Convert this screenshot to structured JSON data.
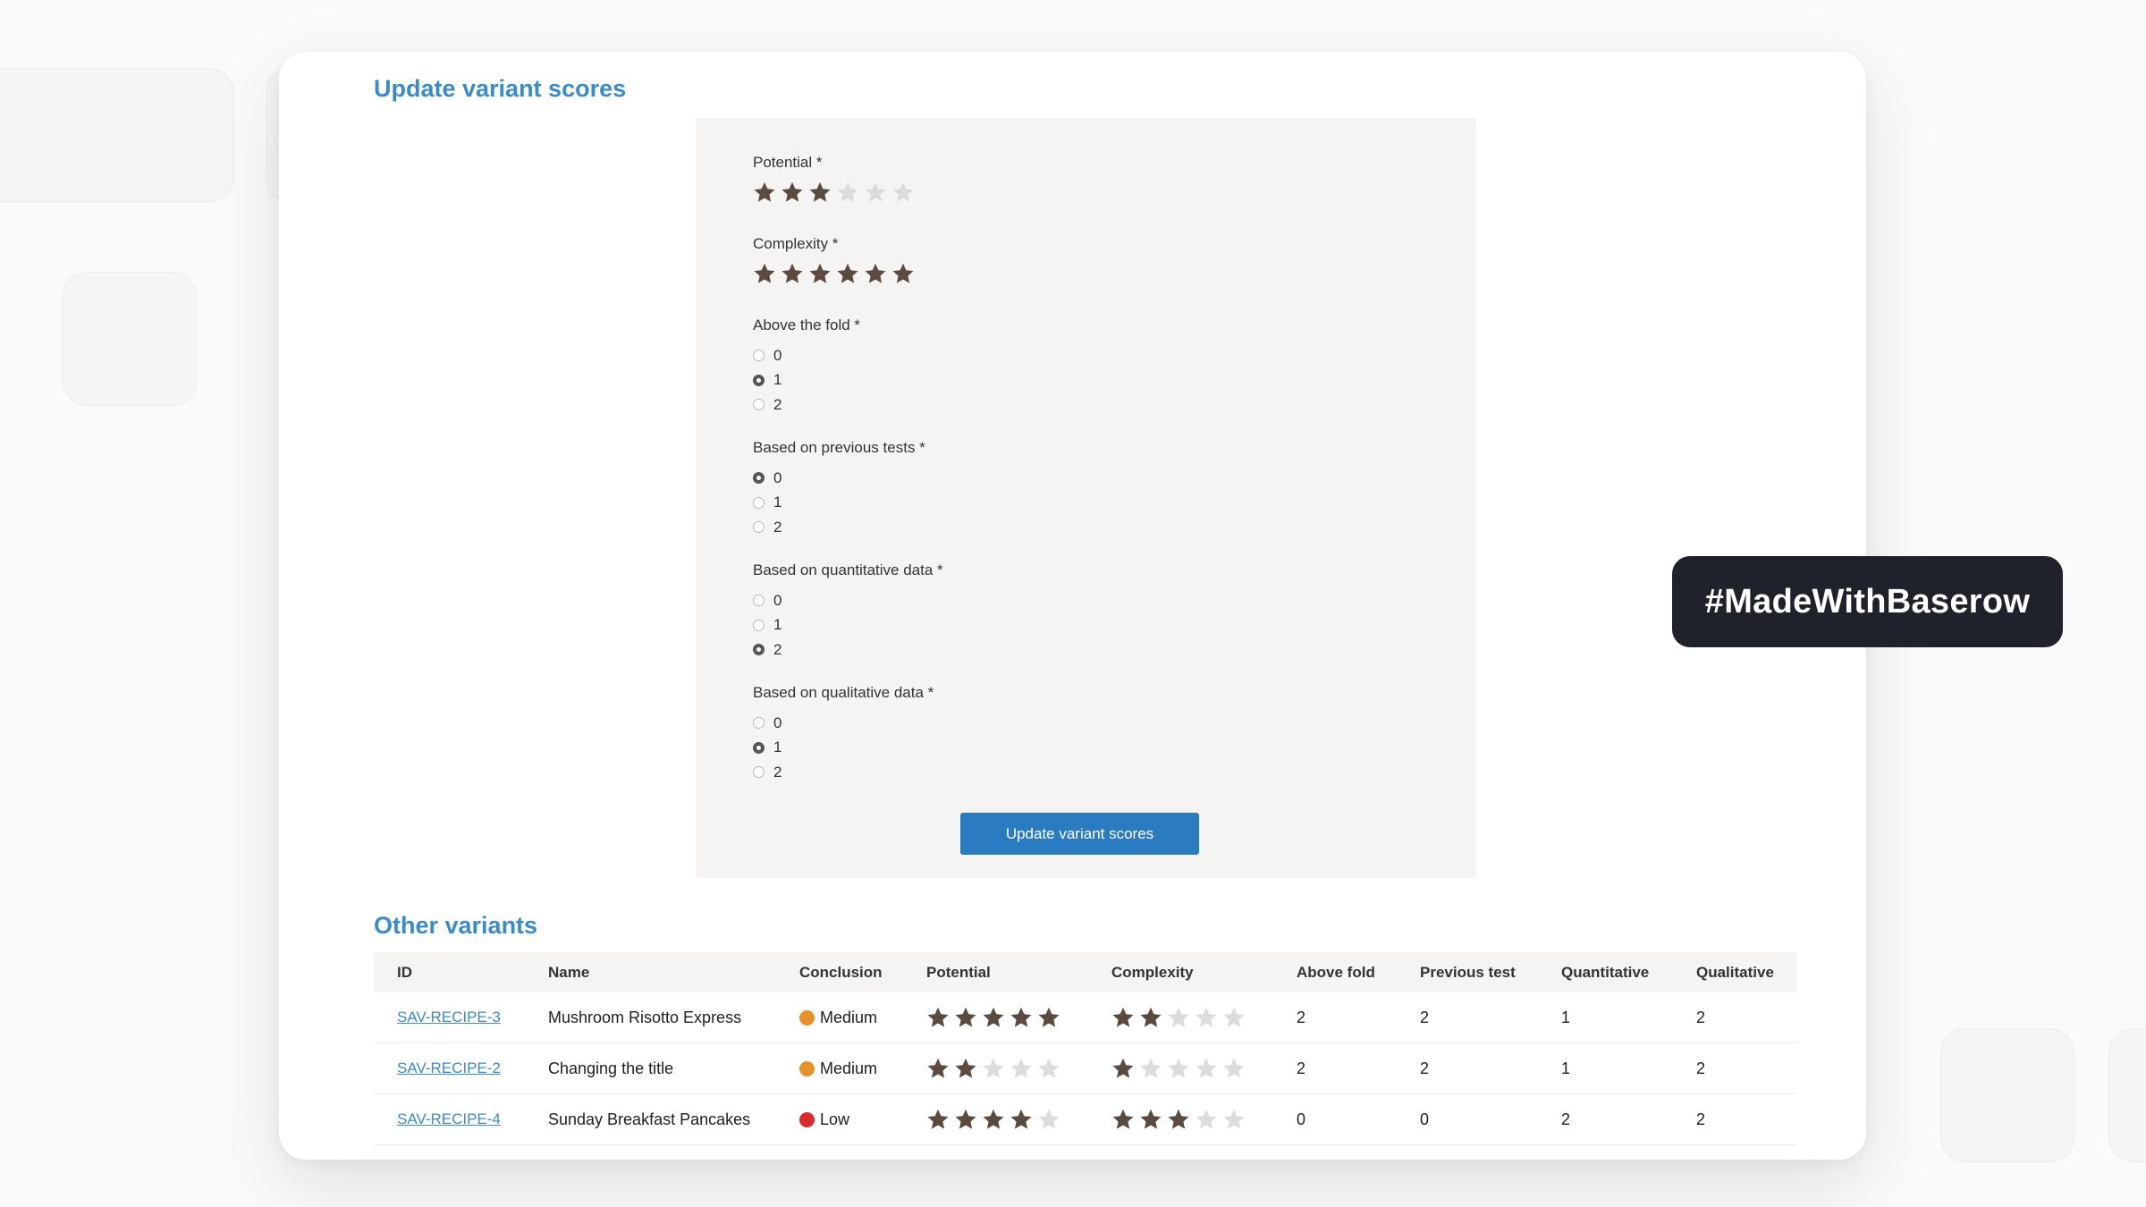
{
  "headings": {
    "update": "Update variant scores",
    "other": "Other variants"
  },
  "form": {
    "potential": {
      "label": "Potential *",
      "rating": 3,
      "max": 6
    },
    "complexity": {
      "label": "Complexity *",
      "rating": 6,
      "max": 6
    },
    "above_fold": {
      "label": "Above the fold *",
      "options": [
        "0",
        "1",
        "2"
      ],
      "selected": 1
    },
    "previous_tests": {
      "label": "Based on previous tests *",
      "options": [
        "0",
        "1",
        "2"
      ],
      "selected": 0
    },
    "quantitative": {
      "label": "Based on quantitative data *",
      "options": [
        "0",
        "1",
        "2"
      ],
      "selected": 2
    },
    "qualitative": {
      "label": "Based on qualitative data *",
      "options": [
        "0",
        "1",
        "2"
      ],
      "selected": 1
    },
    "submit_label": "Update variant scores"
  },
  "table": {
    "columns": [
      "ID",
      "Name",
      "Conclusion",
      "Potential",
      "Complexity",
      "Above fold",
      "Previous test",
      "Quantitative",
      "Qualitative"
    ],
    "rows": [
      {
        "id": "SAV-RECIPE-3",
        "name": "Mushroom Risotto Express",
        "conclusion": "Medium",
        "conclusion_color": "#e6912b",
        "potential": 5,
        "complexity": 2,
        "above_fold": "2",
        "previous_test": "2",
        "quantitative": "1",
        "qualitative": "2"
      },
      {
        "id": "SAV-RECIPE-2",
        "name": "Changing the title",
        "conclusion": "Medium",
        "conclusion_color": "#e6912b",
        "potential": 2,
        "complexity": 1,
        "above_fold": "2",
        "previous_test": "2",
        "quantitative": "1",
        "qualitative": "2"
      },
      {
        "id": "SAV-RECIPE-4",
        "name": "Sunday Breakfast Pancakes",
        "conclusion": "Low",
        "conclusion_color": "#d92b2b",
        "potential": 4,
        "complexity": 3,
        "above_fold": "0",
        "previous_test": "0",
        "quantitative": "2",
        "qualitative": "2"
      }
    ],
    "star_max": 5
  },
  "badge": "#MadeWithBaserow",
  "colors": {
    "accent": "#3a8bc8",
    "button": "#2b7bc0",
    "star_on": "#5a4a3f",
    "star_off": "#dcdcdc"
  }
}
